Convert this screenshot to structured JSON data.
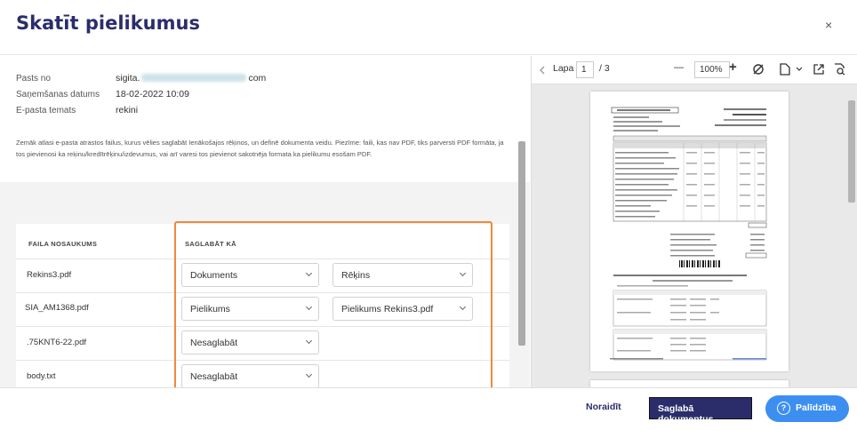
{
  "header": {
    "title": "Skatīt pielikumus",
    "close_label": "×"
  },
  "info": {
    "from_label": "Pasts no",
    "from_value_start": "sigita.",
    "from_value_end": "com",
    "received_label": "Saņemšanas datums",
    "received_value": "18-02-2022 10:09",
    "subject_label": "E-pasta temats",
    "subject_value": "rekini"
  },
  "note": "Zemāk atlasi e-pasta atrastos failus, kurus vēlies saglabāt Ienākošajos rēķinos, un definē dokumenta veidu. Piezīme: faili, kas nav PDF, tiks parversti PDF formāta, ja tos pievienosi ka reķinu/kredītrēķinu/izdevumus, vai arī varesi tos pievienot sakotnēja formata ka pielikumu esošam PDF.",
  "table": {
    "col_filename": "FAILA NOSAUKUMS",
    "col_save_as": "SAGLABĀT KĀ",
    "rows": [
      {
        "filename": "Rekins3.pdf",
        "type": "Dokuments",
        "subtype": "Rēķins"
      },
      {
        "filename": "SIA_AM1368.pdf",
        "type": "Pielikums",
        "subtype": "Pielikums Rekins3.pdf"
      },
      {
        "filename": ".75KNT6-22.pdf",
        "type": "Nesaglabāt",
        "subtype": ""
      },
      {
        "filename": "body.txt",
        "type": "Nesaglabāt",
        "subtype": ""
      }
    ]
  },
  "viewer": {
    "page_label": "Lapa",
    "page_current": "1",
    "page_total": "/ 3",
    "zoom": "100%",
    "minus": "—",
    "plus": "+"
  },
  "footer": {
    "cancel_label": "Noraidīt",
    "save_label": "Saglabā dokumentus",
    "help_label": "Palīdzība",
    "help_icon": "?"
  },
  "colors": {
    "brand": "#2b2d6b",
    "highlight": "#f0893a",
    "help": "#3c8ff0"
  }
}
